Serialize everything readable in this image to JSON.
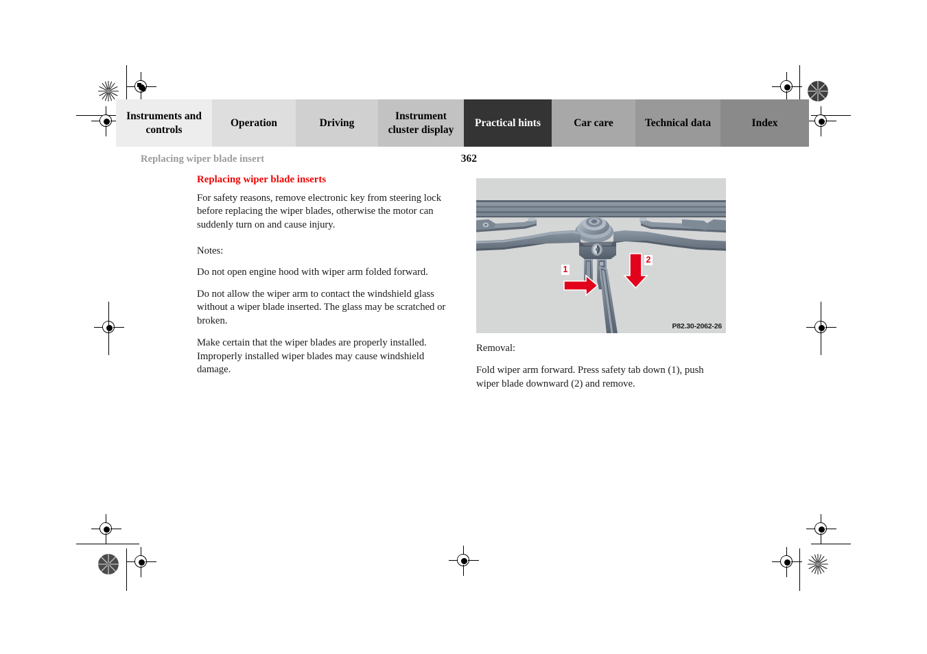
{
  "document": {
    "running_header": "Replacing wiper blade insert",
    "page_number": "362"
  },
  "tabbar": {
    "tabs": [
      {
        "label": "Instruments and controls",
        "bg": "#ededed",
        "active": false
      },
      {
        "label": "Operation",
        "bg": "#dedede",
        "active": false
      },
      {
        "label": "Driving",
        "bg": "#d0d0d0",
        "active": false
      },
      {
        "label": "Instrument cluster display",
        "bg": "#c2c2c2",
        "active": false
      },
      {
        "label": "Practical hints",
        "bg": "#343434",
        "active": true
      },
      {
        "label": "Car care",
        "bg": "#a8a8a8",
        "active": false
      },
      {
        "label": "Technical data",
        "bg": "#999999",
        "active": false
      },
      {
        "label": "Index",
        "bg": "#8a8a8a",
        "active": false
      }
    ]
  },
  "content": {
    "heading": "Replacing wiper blade inserts",
    "warning": "For safety reasons, remove electronic key from steering lock before replacing the wiper blades, otherwise the motor can suddenly turn on and cause injury.",
    "notes_label": "Notes:",
    "note_1": "Do not open engine hood with wiper arm folded forward.",
    "note_2": "Do not allow the wiper arm to contact the windshield glass without a wiper blade inserted. The glass may be scratched or broken.",
    "note_3": "Make certain that the wiper blades are properly installed. Improperly installed wiper blades may cause windshield damage."
  },
  "figure": {
    "image_code": "P82.30-2062-26",
    "callout_1": "1",
    "callout_2": "2",
    "arrow_color": "#e2021b",
    "background": "#d5d6d6",
    "description": "Wiper arm folded forward showing safety tab and wiper blade attachment"
  },
  "right_column": {
    "removal_label": "Removal:",
    "removal_text": "Fold wiper arm forward. Press safety tab down (1), push wiper blade downward (2) and remove."
  },
  "colors": {
    "heading_red": "#ee0000",
    "running_head_gray": "#9a9a9a",
    "active_tab": "#343434"
  }
}
